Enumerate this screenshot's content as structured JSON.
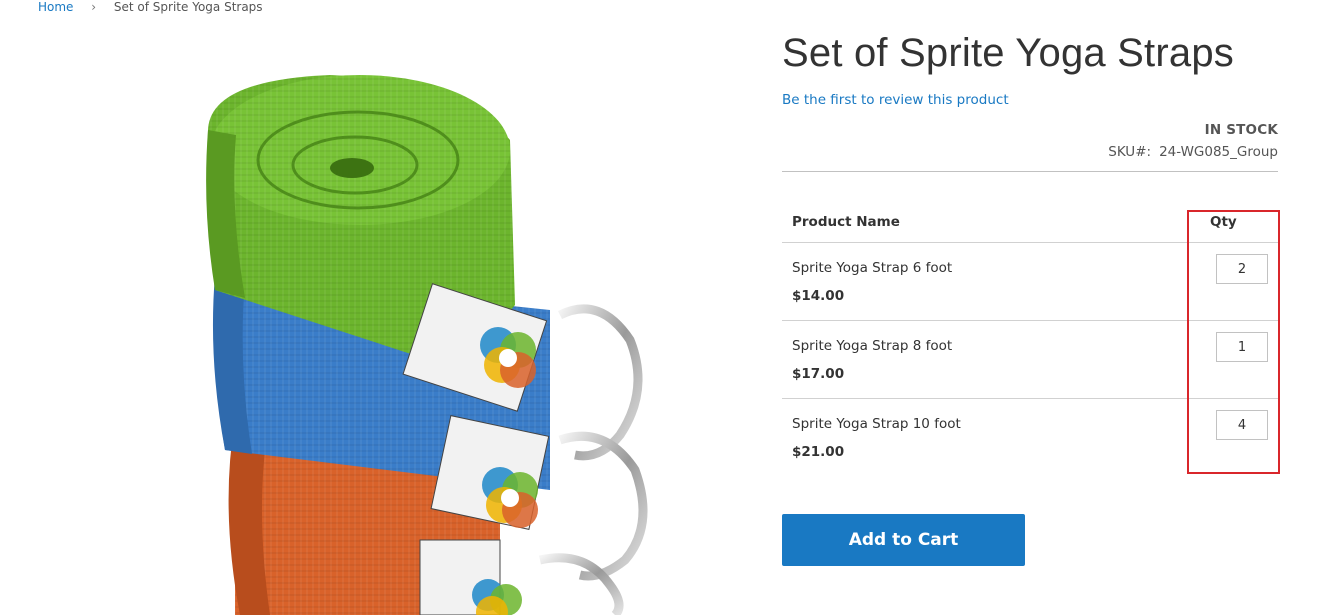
{
  "breadcrumb": {
    "home": "Home",
    "separator": "›",
    "current": "Set of Sprite Yoga Straps"
  },
  "product": {
    "title": "Set of Sprite Yoga Straps",
    "review_link": "Be the first to review this product",
    "stock": "IN STOCK",
    "sku_label": "SKU#:",
    "sku_value": "24-WG085_Group",
    "image_icon": "yoga-straps-image"
  },
  "grouped_table": {
    "col_name": "Product Name",
    "col_qty": "Qty",
    "rows": [
      {
        "name": "Sprite Yoga Strap 6 foot",
        "price": "$14.00",
        "qty": "2"
      },
      {
        "name": "Sprite Yoga Strap 8 foot",
        "price": "$17.00",
        "qty": "1"
      },
      {
        "name": "Sprite Yoga Strap 10 foot",
        "price": "$21.00",
        "qty": "4"
      }
    ]
  },
  "actions": {
    "add_to_cart": "Add to Cart"
  },
  "colors": {
    "accent_blue": "#1979c3",
    "highlight_red": "#d9262b",
    "strap_green": "#6cb52d",
    "strap_blue": "#3a7dc9",
    "strap_orange": "#d9622a"
  }
}
